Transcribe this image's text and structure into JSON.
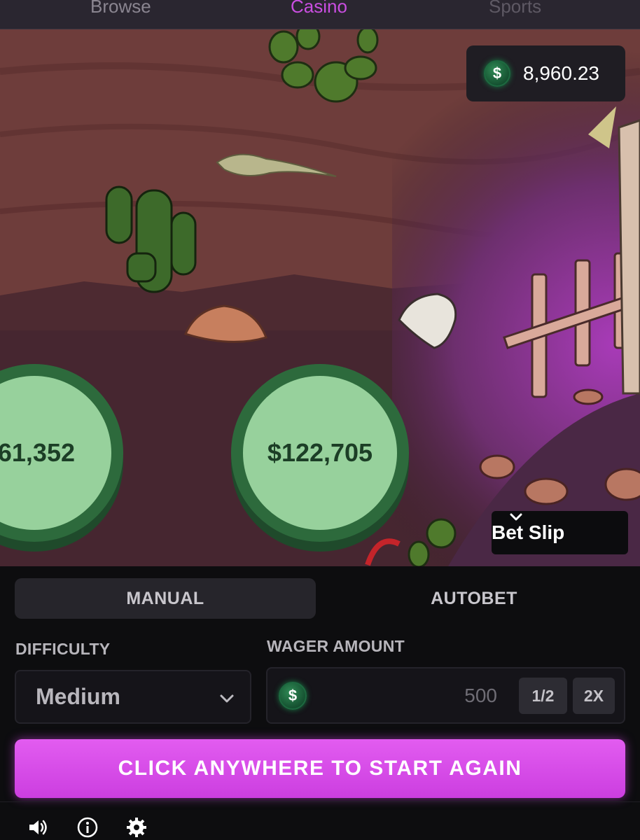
{
  "nav": {
    "browse": "Browse",
    "casino": "Casino",
    "sports": "Sports",
    "active_color": "#c94ee0"
  },
  "balance": {
    "currency_symbol": "$",
    "amount": "8,960.23"
  },
  "game": {
    "chips": [
      {
        "label": "61,352"
      },
      {
        "label": "$122,705"
      }
    ],
    "chip_color": "#97d19c"
  },
  "bet_slip": {
    "label": "Bet Slip",
    "icon": "chevron-down-icon"
  },
  "panel": {
    "tabs": [
      {
        "label": "MANUAL",
        "active": true
      },
      {
        "label": "AUTOBET",
        "active": false
      }
    ],
    "difficulty": {
      "label": "DIFFICULTY",
      "value": "Medium"
    },
    "wager": {
      "label": "WAGER AMOUNT",
      "currency_symbol": "$",
      "value": "500",
      "half_label": "1/2",
      "double_label": "2X"
    },
    "start_button": {
      "label": "CLICK ANYWHERE TO START AGAIN",
      "color": "#d94ae9"
    }
  },
  "footer": {
    "icons": [
      "sound-icon",
      "info-icon",
      "gear-icon"
    ]
  }
}
